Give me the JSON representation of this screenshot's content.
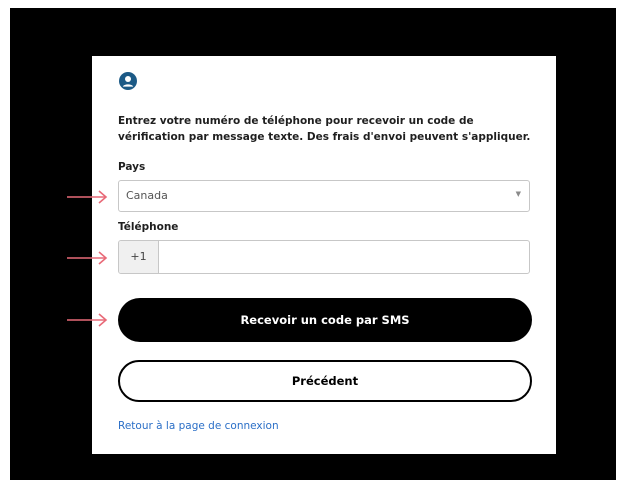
{
  "form": {
    "intro_text": "Entrez votre numéro de téléphone pour recevoir un code de vérification par message texte. Des frais d'envoi peuvent s'appliquer.",
    "country_label": "Pays",
    "country_value": "Canada",
    "phone_label": "Téléphone",
    "phone_prefix": "+1",
    "phone_value": "",
    "send_code_button": "Recevoir un code par SMS",
    "previous_button": "Précédent",
    "back_link": "Retour à la page de connexion"
  },
  "icons": {
    "user": "user-circle-icon",
    "caret": "caret-down-icon",
    "annotation_arrow": "arrow-right-icon"
  },
  "colors": {
    "backdrop": "#000000",
    "primary_button": "#000000",
    "link": "#2b6fc7",
    "user_icon": "#1c5a86",
    "annotation_arrow": "#e86a78"
  }
}
